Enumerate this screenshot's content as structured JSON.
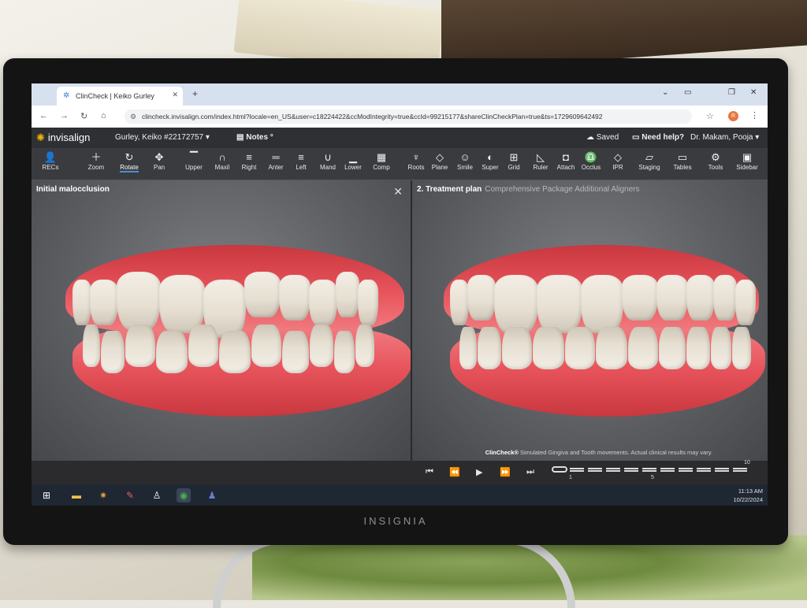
{
  "browser": {
    "tab_title": "ClinCheck | Keiko Gurley",
    "new_tab": "+",
    "url": "clincheck.invisalign.com/index.html?locale=en_US&user=c18224422&ccModIntegrity=true&ccId=99215177&shareClinCheckPlan=true&ts=1729609642492",
    "profile_initial": "R"
  },
  "app": {
    "logo": "invisalign",
    "patient": "Gurley, Keiko #22172757",
    "notes_label": "Notes",
    "saved_label": "Saved",
    "help_label": "Need help?",
    "doctor": "Dr. Makam, Pooja"
  },
  "toolbar": [
    {
      "label": "RECs",
      "icon": "person-icon"
    },
    {
      "label": "Zoom",
      "icon": "zoom-icon"
    },
    {
      "label": "Rotate",
      "icon": "rotate-icon"
    },
    {
      "label": "Pan",
      "icon": "pan-icon"
    },
    {
      "label": "Upper",
      "icon": "upper-icon"
    },
    {
      "label": "Maxil",
      "icon": "maxil-icon"
    },
    {
      "label": "Right",
      "icon": "right-icon"
    },
    {
      "label": "Anter",
      "icon": "anter-icon"
    },
    {
      "label": "Left",
      "icon": "left-icon"
    },
    {
      "label": "Mand",
      "icon": "mand-icon"
    },
    {
      "label": "Lower",
      "icon": "lower-icon"
    },
    {
      "label": "Comp",
      "icon": "comp-icon"
    },
    {
      "label": "Roots",
      "icon": "roots-icon"
    },
    {
      "label": "Plane",
      "icon": "plane-icon"
    },
    {
      "label": "Smile",
      "icon": "smile-icon"
    },
    {
      "label": "Super",
      "icon": "super-icon"
    },
    {
      "label": "Grid",
      "icon": "grid-icon"
    },
    {
      "label": "Ruler",
      "icon": "ruler-icon"
    },
    {
      "label": "Attach",
      "icon": "attach-icon"
    },
    {
      "label": "Occlus",
      "icon": "occlus-icon"
    },
    {
      "label": "IPR",
      "icon": "ipr-icon"
    },
    {
      "label": "Staging",
      "icon": "staging-icon"
    },
    {
      "label": "Tables",
      "icon": "tables-icon"
    },
    {
      "label": "Tools",
      "icon": "tools-icon"
    },
    {
      "label": "Sidebar",
      "icon": "sidebar-icon"
    }
  ],
  "left_view": {
    "title": "Initial malocclusion",
    "close": "✕"
  },
  "right_view": {
    "title": "2. Treatment plan",
    "subtitle": "Comprehensive Package Additional Aligners",
    "disclaimer_brand": "ClinCheck®",
    "disclaimer_text": "Simulated Gingiva and Tooth movements. Actual clinical results may vary."
  },
  "stages": {
    "labels": [
      "1",
      "5",
      "10"
    ]
  },
  "taskbar": {
    "time": "11:13 AM",
    "date": "10/22/2024"
  },
  "monitor": {
    "brand": "INSIGNIA"
  }
}
